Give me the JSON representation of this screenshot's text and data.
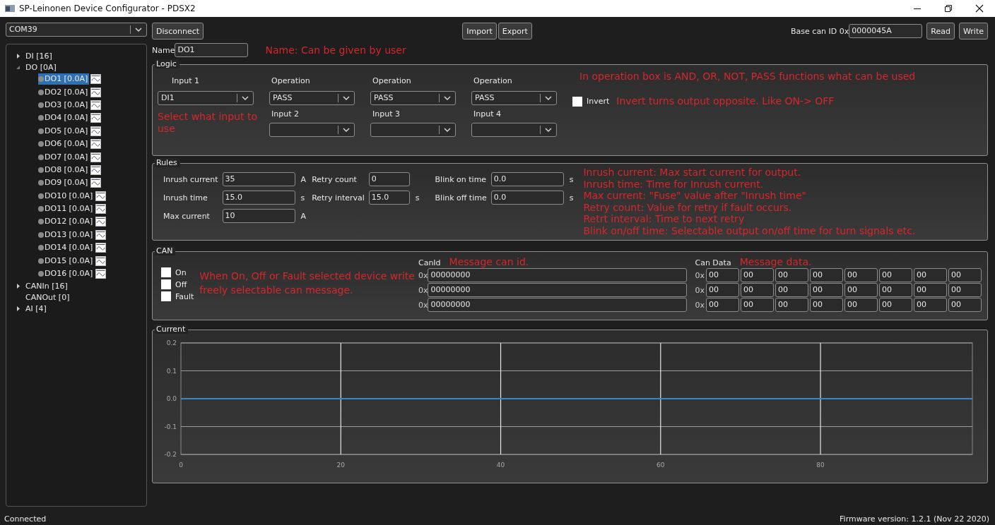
{
  "window": {
    "title": "SP-Leinonen Device Configurator - PDSX2"
  },
  "toolbar": {
    "port": "COM39",
    "connect_button": "Disconnect",
    "import_button": "Import",
    "export_button": "Export",
    "base_id_label": "Base can ID 0x",
    "base_id_value": "0000045A",
    "read_button": "Read",
    "write_button": "Write"
  },
  "tree": [
    {
      "label": "DI [16]",
      "expandable": true,
      "expanded": false
    },
    {
      "label": "DO [0A]",
      "expandable": true,
      "expanded": true,
      "children": [
        {
          "label": "DO1 [0.0A]",
          "selected": true
        },
        {
          "label": "DO2 [0.0A]",
          "selected": false
        },
        {
          "label": "DO3 [0.0A]",
          "selected": false
        },
        {
          "label": "DO4 [0.0A]",
          "selected": false
        },
        {
          "label": "DO5 [0.0A]",
          "selected": false
        },
        {
          "label": "DO6 [0.0A]",
          "selected": false
        },
        {
          "label": "DO7 [0.0A]",
          "selected": false
        },
        {
          "label": "DO8 [0.0A]",
          "selected": false
        },
        {
          "label": "DO9 [0.0A]",
          "selected": false
        },
        {
          "label": "DO10 [0.0A]",
          "selected": false
        },
        {
          "label": "DO11 [0.0A]",
          "selected": false
        },
        {
          "label": "DO12 [0.0A]",
          "selected": false
        },
        {
          "label": "DO13 [0.0A]",
          "selected": false
        },
        {
          "label": "DO14 [0.0A]",
          "selected": false
        },
        {
          "label": "DO15 [0.0A]",
          "selected": false
        },
        {
          "label": "DO16 [0.0A]",
          "selected": false
        }
      ]
    },
    {
      "label": "CANIn [16]",
      "expandable": true,
      "expanded": false
    },
    {
      "label": "CANOut [0]",
      "expandable": false,
      "expanded": false
    },
    {
      "label": "AI [4]",
      "expandable": true,
      "expanded": false
    }
  ],
  "name_field": {
    "label": "Name",
    "value": "DO1",
    "note": "Name: Can be given by user"
  },
  "logic": {
    "title": "Logic",
    "note": "In operation box is AND, OR, NOT, PASS functions what can be used",
    "input_1": {
      "label": "Input 1",
      "value": "DI1"
    },
    "input_note": "Select what input to use",
    "operations": [
      {
        "label": "Operation",
        "value": "PASS",
        "input_label": "Input 2"
      },
      {
        "label": "Operation",
        "value": "PASS",
        "input_label": "Input 3"
      },
      {
        "label": "Operation",
        "value": "PASS",
        "input_label": "Input 4"
      }
    ],
    "invert": {
      "label": "Invert",
      "checked": false,
      "note": "Invert turns output opposite. Like ON-> OFF"
    }
  },
  "rules": {
    "title": "Rules",
    "columns": [
      [
        {
          "label": "Inrush current",
          "value": "35",
          "unit": "A"
        },
        {
          "label": "Inrush time",
          "value": "15.0",
          "unit": "s"
        },
        {
          "label": "Max current",
          "value": "10",
          "unit": "A"
        }
      ],
      [
        {
          "label": "Retry count",
          "value": "0"
        },
        {
          "label": "Retry interval",
          "value": "15.0",
          "unit": "s"
        }
      ],
      [
        {
          "label": "Blink on time",
          "value": "0.0",
          "unit": "s"
        },
        {
          "label": "Blink off time",
          "value": "0.0",
          "unit": "s"
        }
      ]
    ],
    "notes": [
      "Inrush current: Max start current for output.",
      "Inrush time: Time for Inrush current.",
      "Max current: \"Fuse\" value after \"Inrush time\"",
      "Retry count: Value for retry if fault occurs.",
      "Retrt interval: Time to next retry",
      "Blink on/off time: Selectable output on/off time for turn signals etc."
    ]
  },
  "can": {
    "title": "CAN",
    "triggers": [
      {
        "label": "On",
        "checked": false
      },
      {
        "label": "Off",
        "checked": false
      },
      {
        "label": "Fault",
        "checked": false
      }
    ],
    "note": "When On, Off or Fault selected device write freely selectable can message.",
    "id_label": "CanId",
    "id_note": "Message can id.",
    "data_label": "Can Data",
    "data_note": "Message data.",
    "messages": [
      {
        "id_prefix": "0x",
        "id": "00000000",
        "data_prefix": "0x",
        "data": [
          "00",
          "00",
          "00",
          "00",
          "00",
          "00",
          "00",
          "00"
        ]
      },
      {
        "id_prefix": "0x",
        "id": "00000000",
        "data_prefix": "0x",
        "data": [
          "00",
          "00",
          "00",
          "00",
          "00",
          "00",
          "00",
          "00"
        ]
      },
      {
        "id_prefix": "0x",
        "id": "00000000",
        "data_prefix": "0x",
        "data": [
          "00",
          "00",
          "00",
          "00",
          "00",
          "00",
          "00",
          "00"
        ]
      }
    ]
  },
  "current": {
    "title": "Current",
    "chart_data": {
      "type": "line",
      "grid": true,
      "x": [
        0,
        99
      ],
      "xlim": [
        0,
        99
      ],
      "ylim": [
        -0.2,
        0.2
      ],
      "xticks": [
        0,
        20,
        40,
        60,
        80
      ],
      "yticks": [
        {
          "value": -0.2,
          "label": "-0.2"
        },
        {
          "value": -0.1,
          "label": "-0.1"
        },
        {
          "value": 0,
          "label": "0.0"
        },
        {
          "value": 0.1,
          "label": "0.1"
        },
        {
          "value": 0.2,
          "label": "0.2"
        }
      ],
      "series": [
        {
          "color": "#3d86c6",
          "values": [
            0,
            0
          ]
        }
      ]
    }
  },
  "status_bar": {
    "left": "Connected",
    "right": "Firmware version: 1.2.1 (Nov 22 2020)"
  }
}
